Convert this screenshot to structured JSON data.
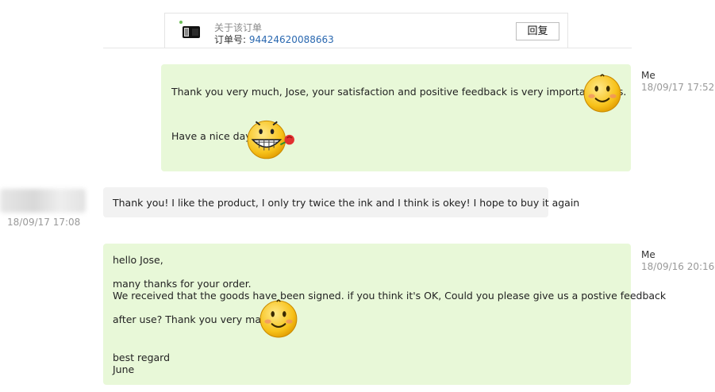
{
  "order": {
    "title": "关于该订单",
    "number_label": "订单号: ",
    "number": "94424620088663",
    "reply_label": "回复"
  },
  "messages": [
    {
      "sender": "Me",
      "time": "18/09/17 17:52",
      "line1": "Thank you very much, Jose, your satisfaction and positive feedback is very important to us.",
      "line2": "Have a nice day!"
    },
    {
      "time": "18/09/17 17:08",
      "line1": "Thank you! I like the product, I only try twice the ink and I think is okey! I hope to buy it again"
    },
    {
      "sender": "Me",
      "time": "18/09/16 20:16",
      "lines": [
        "hello Jose,",
        "many thanks for your order.",
        "We received that the goods have been signed. if you think it's OK, Could you please give us a postive feedback",
        "after use? Thank you very mach.",
        "best regard",
        "June"
      ]
    }
  ],
  "colors": {
    "my_bubble": "#e8f8d8",
    "their_bubble": "#f2f2f2",
    "order_number": "#2a68b0"
  },
  "icons": [
    "product-thumbnail",
    "smiley-emoji",
    "grinning-rose-emoji",
    "smiley-emoji"
  ]
}
